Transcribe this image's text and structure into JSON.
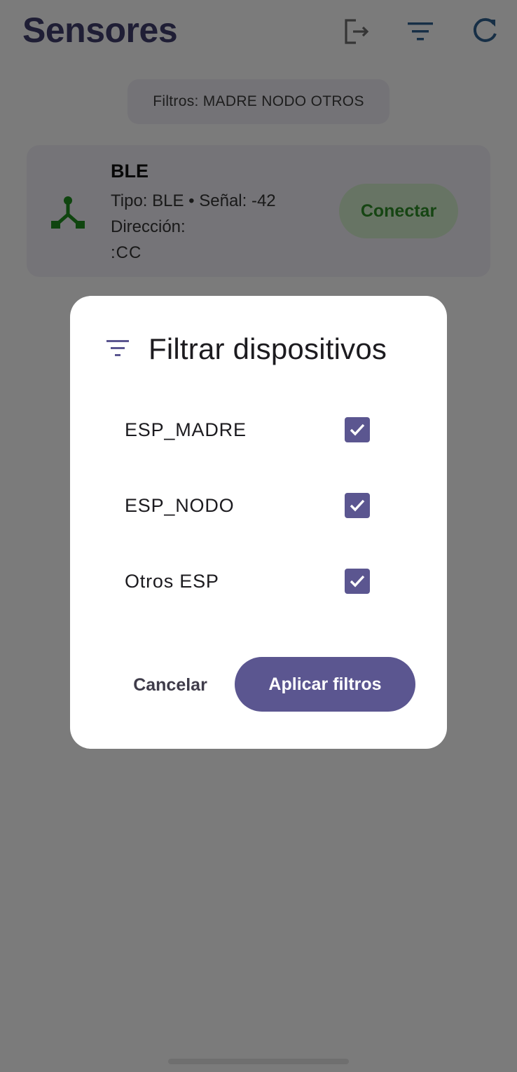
{
  "app": {
    "title": "Sensores",
    "icons": [
      "logout-icon",
      "filter-icon",
      "refresh-icon"
    ]
  },
  "filters_chip": "Filtros: MADRE NODO OTROS",
  "device": {
    "name": "BLE",
    "meta": "Tipo: BLE • Señal: -42",
    "address_label": "Dirección:",
    "address": ":CC",
    "connect_label": "Conectar",
    "icon": "hub-icon"
  },
  "dialog": {
    "title": "Filtrar dispositivos",
    "icon": "filter-list-icon",
    "options": [
      {
        "label": "ESP_MADRE",
        "checked": true
      },
      {
        "label": "ESP_NODO",
        "checked": true
      },
      {
        "label": "Otros ESP",
        "checked": true
      }
    ],
    "cancel_label": "Cancelar",
    "apply_label": "Aplicar filtros"
  },
  "colors": {
    "primary": "#5b5690",
    "title": "#3f3c6b",
    "connect_green": "#2d8a27",
    "connect_bg": "#cfe8c9"
  }
}
